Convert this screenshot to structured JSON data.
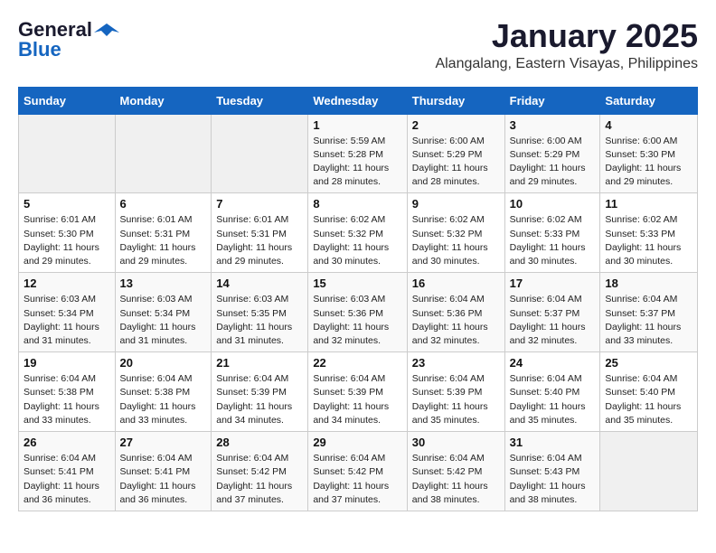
{
  "logo": {
    "line1": "General",
    "line2": "Blue"
  },
  "title": "January 2025",
  "subtitle": "Alangalang, Eastern Visayas, Philippines",
  "header_row": [
    "Sunday",
    "Monday",
    "Tuesday",
    "Wednesday",
    "Thursday",
    "Friday",
    "Saturday"
  ],
  "weeks": [
    [
      {
        "day": "",
        "info": ""
      },
      {
        "day": "",
        "info": ""
      },
      {
        "day": "",
        "info": ""
      },
      {
        "day": "1",
        "info": "Sunrise: 5:59 AM\nSunset: 5:28 PM\nDaylight: 11 hours\nand 28 minutes."
      },
      {
        "day": "2",
        "info": "Sunrise: 6:00 AM\nSunset: 5:29 PM\nDaylight: 11 hours\nand 28 minutes."
      },
      {
        "day": "3",
        "info": "Sunrise: 6:00 AM\nSunset: 5:29 PM\nDaylight: 11 hours\nand 29 minutes."
      },
      {
        "day": "4",
        "info": "Sunrise: 6:00 AM\nSunset: 5:30 PM\nDaylight: 11 hours\nand 29 minutes."
      }
    ],
    [
      {
        "day": "5",
        "info": "Sunrise: 6:01 AM\nSunset: 5:30 PM\nDaylight: 11 hours\nand 29 minutes."
      },
      {
        "day": "6",
        "info": "Sunrise: 6:01 AM\nSunset: 5:31 PM\nDaylight: 11 hours\nand 29 minutes."
      },
      {
        "day": "7",
        "info": "Sunrise: 6:01 AM\nSunset: 5:31 PM\nDaylight: 11 hours\nand 29 minutes."
      },
      {
        "day": "8",
        "info": "Sunrise: 6:02 AM\nSunset: 5:32 PM\nDaylight: 11 hours\nand 30 minutes."
      },
      {
        "day": "9",
        "info": "Sunrise: 6:02 AM\nSunset: 5:32 PM\nDaylight: 11 hours\nand 30 minutes."
      },
      {
        "day": "10",
        "info": "Sunrise: 6:02 AM\nSunset: 5:33 PM\nDaylight: 11 hours\nand 30 minutes."
      },
      {
        "day": "11",
        "info": "Sunrise: 6:02 AM\nSunset: 5:33 PM\nDaylight: 11 hours\nand 30 minutes."
      }
    ],
    [
      {
        "day": "12",
        "info": "Sunrise: 6:03 AM\nSunset: 5:34 PM\nDaylight: 11 hours\nand 31 minutes."
      },
      {
        "day": "13",
        "info": "Sunrise: 6:03 AM\nSunset: 5:34 PM\nDaylight: 11 hours\nand 31 minutes."
      },
      {
        "day": "14",
        "info": "Sunrise: 6:03 AM\nSunset: 5:35 PM\nDaylight: 11 hours\nand 31 minutes."
      },
      {
        "day": "15",
        "info": "Sunrise: 6:03 AM\nSunset: 5:36 PM\nDaylight: 11 hours\nand 32 minutes."
      },
      {
        "day": "16",
        "info": "Sunrise: 6:04 AM\nSunset: 5:36 PM\nDaylight: 11 hours\nand 32 minutes."
      },
      {
        "day": "17",
        "info": "Sunrise: 6:04 AM\nSunset: 5:37 PM\nDaylight: 11 hours\nand 32 minutes."
      },
      {
        "day": "18",
        "info": "Sunrise: 6:04 AM\nSunset: 5:37 PM\nDaylight: 11 hours\nand 33 minutes."
      }
    ],
    [
      {
        "day": "19",
        "info": "Sunrise: 6:04 AM\nSunset: 5:38 PM\nDaylight: 11 hours\nand 33 minutes."
      },
      {
        "day": "20",
        "info": "Sunrise: 6:04 AM\nSunset: 5:38 PM\nDaylight: 11 hours\nand 33 minutes."
      },
      {
        "day": "21",
        "info": "Sunrise: 6:04 AM\nSunset: 5:39 PM\nDaylight: 11 hours\nand 34 minutes."
      },
      {
        "day": "22",
        "info": "Sunrise: 6:04 AM\nSunset: 5:39 PM\nDaylight: 11 hours\nand 34 minutes."
      },
      {
        "day": "23",
        "info": "Sunrise: 6:04 AM\nSunset: 5:39 PM\nDaylight: 11 hours\nand 35 minutes."
      },
      {
        "day": "24",
        "info": "Sunrise: 6:04 AM\nSunset: 5:40 PM\nDaylight: 11 hours\nand 35 minutes."
      },
      {
        "day": "25",
        "info": "Sunrise: 6:04 AM\nSunset: 5:40 PM\nDaylight: 11 hours\nand 35 minutes."
      }
    ],
    [
      {
        "day": "26",
        "info": "Sunrise: 6:04 AM\nSunset: 5:41 PM\nDaylight: 11 hours\nand 36 minutes."
      },
      {
        "day": "27",
        "info": "Sunrise: 6:04 AM\nSunset: 5:41 PM\nDaylight: 11 hours\nand 36 minutes."
      },
      {
        "day": "28",
        "info": "Sunrise: 6:04 AM\nSunset: 5:42 PM\nDaylight: 11 hours\nand 37 minutes."
      },
      {
        "day": "29",
        "info": "Sunrise: 6:04 AM\nSunset: 5:42 PM\nDaylight: 11 hours\nand 37 minutes."
      },
      {
        "day": "30",
        "info": "Sunrise: 6:04 AM\nSunset: 5:42 PM\nDaylight: 11 hours\nand 38 minutes."
      },
      {
        "day": "31",
        "info": "Sunrise: 6:04 AM\nSunset: 5:43 PM\nDaylight: 11 hours\nand 38 minutes."
      },
      {
        "day": "",
        "info": ""
      }
    ]
  ]
}
